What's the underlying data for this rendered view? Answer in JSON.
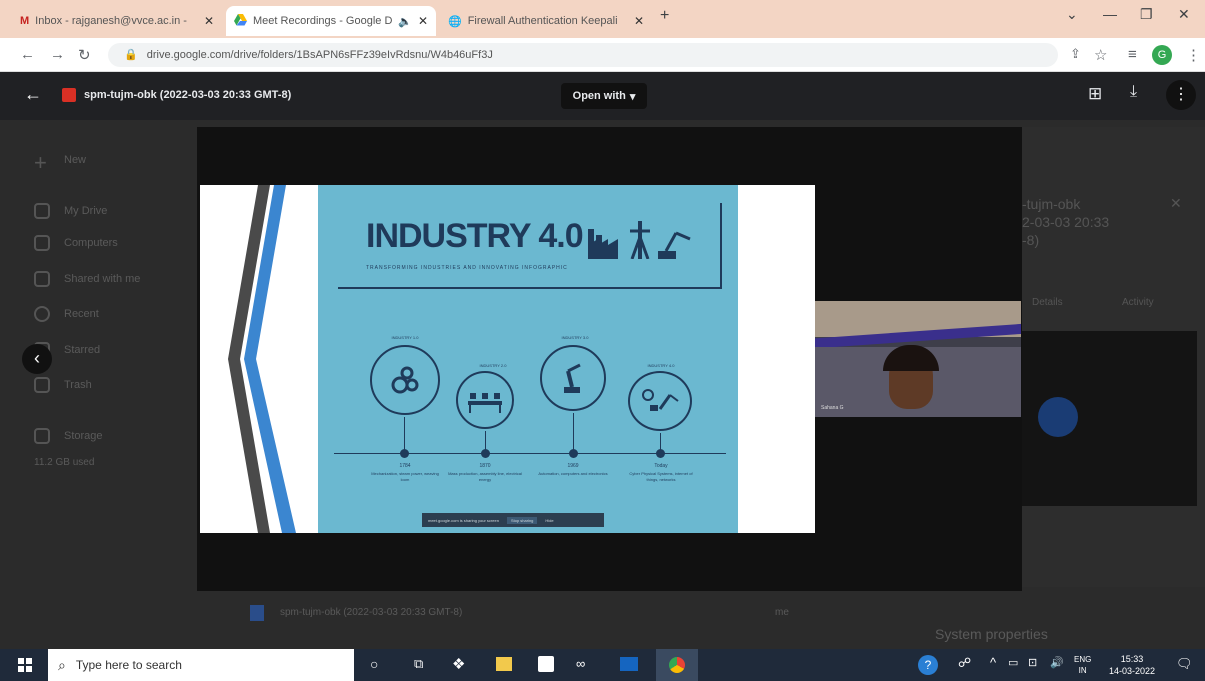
{
  "browser": {
    "tabs": [
      {
        "label": "Inbox - rajganesh@vvce.ac.in - ",
        "icon": "gmail-icon"
      },
      {
        "label": "Meet Recordings - Google D",
        "icon": "drive-icon",
        "audio": true
      },
      {
        "label": "Firewall Authentication Keepali",
        "icon": "globe-icon"
      }
    ],
    "new_tab": "+",
    "url": "drive.google.com/drive/folders/1BsAPN6sFFz39eIvRdsnu/W4b46uFf3J",
    "profile_initial": "G"
  },
  "viewer": {
    "file_title": "spm-tujm-obk (2022-03-03 20:33 GMT-8)",
    "open_with": "Open with",
    "open_with_arrow": "▾"
  },
  "background_drive": {
    "new_label": "New",
    "sidebar_items": [
      "My Drive",
      "Computers",
      "Shared with me",
      "Recent",
      "Starred",
      "Trash",
      "Storage"
    ],
    "storage_text": "11.2 GB used",
    "details_title_lines": [
      "-tujm-obk",
      "2-03-03 20:33",
      "-8)"
    ],
    "details_tabs": [
      "Details",
      "Activity"
    ],
    "system_properties": "System properties",
    "file_row_name": "spm-tujm-obk (2022-03-03 20:33 GMT-8)",
    "file_row_owner": "me"
  },
  "slide": {
    "title": "INDUSTRY 4.0",
    "subtitle": "TRANSFORMING INDUSTRIES AND INNOVATING INFOGRAPHIC",
    "stages": [
      {
        "label": "INDUSTRY 1.0",
        "year": "1784",
        "desc": "Mechanization, steam power, weaving loom"
      },
      {
        "label": "INDUSTRY 2.0",
        "year": "1870",
        "desc": "Mass production, assembly line, electrical energy"
      },
      {
        "label": "INDUSTRY 3.0",
        "year": "1969",
        "desc": "Automation, computers and electronics"
      },
      {
        "label": "INDUSTRY 4.0",
        "year": "Today",
        "desc": "Cyber Physical Systems, internet of things, networks"
      }
    ],
    "share_banner": {
      "text": "meet.google.com is sharing your screen",
      "stop": "Stop sharing",
      "hide": "Hide"
    },
    "colors": {
      "panel": "#6bb8d0",
      "navy": "#1f3a5a",
      "accent": "#3b86d0"
    }
  },
  "camera": {
    "participant": "Sahana G"
  },
  "taskbar": {
    "search_placeholder": "Type here to search",
    "lang_top": "ENG",
    "lang_bottom": "IN",
    "time": "15:33",
    "date": "14-03-2022"
  }
}
